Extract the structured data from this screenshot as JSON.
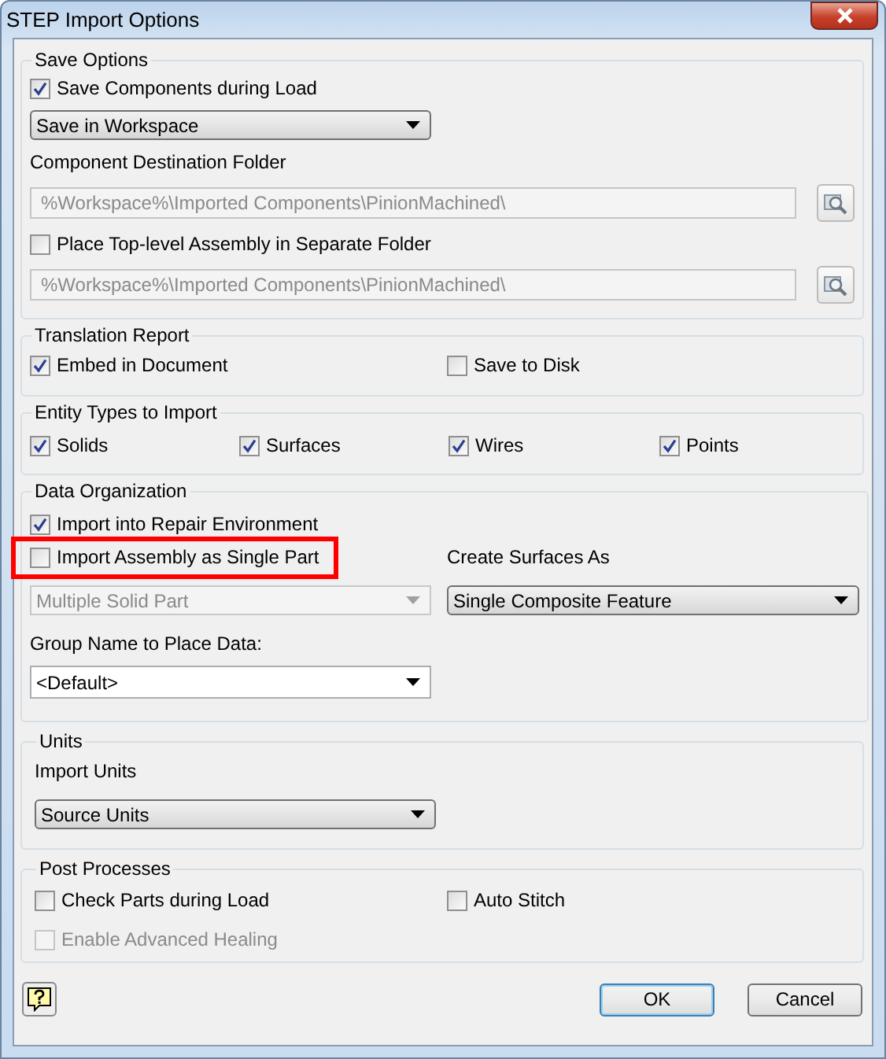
{
  "window": {
    "title": "STEP Import Options"
  },
  "save_options": {
    "title": "Save Options",
    "save_components": {
      "label": "Save Components during Load",
      "checked": true
    },
    "save_location": {
      "value": "Save in Workspace",
      "disabled": false,
      "editable": false
    },
    "destination_label": "Component Destination Folder",
    "destination_folder": {
      "value": "%Workspace%\\Imported Components\\PinionMachined\\",
      "disabled": true
    },
    "separate_folder": {
      "label": "Place Top-level Assembly in Separate Folder",
      "checked": false
    },
    "separate_folder_path": {
      "value": "%Workspace%\\Imported Components\\PinionMachined\\",
      "disabled": true
    }
  },
  "translation_report": {
    "title": "Translation Report",
    "options": [
      {
        "label": "Embed in Document",
        "checked": true
      },
      {
        "label": "Save to Disk",
        "checked": false
      }
    ]
  },
  "entity_types": {
    "title": "Entity Types to Import",
    "options": [
      {
        "label": "Solids",
        "checked": true
      },
      {
        "label": "Surfaces",
        "checked": true
      },
      {
        "label": "Wires",
        "checked": true
      },
      {
        "label": "Points",
        "checked": true
      }
    ]
  },
  "data_organization": {
    "title": "Data Organization",
    "repair": {
      "label": "Import into Repair Environment",
      "checked": true
    },
    "single_part": {
      "label": "Import Assembly as Single Part",
      "checked": false,
      "highlighted": true
    },
    "part_type": {
      "value": "Multiple Solid Part",
      "disabled": true,
      "editable": false
    },
    "surfaces_label": "Create Surfaces As",
    "surfaces": {
      "value": "Single Composite Feature",
      "disabled": false,
      "editable": false
    },
    "group_label": "Group Name to Place Data:",
    "group_name": {
      "value": "<Default>",
      "disabled": false,
      "editable": true
    }
  },
  "units": {
    "title": "Units",
    "label": "Import Units",
    "import_units": {
      "value": "Source Units",
      "disabled": false,
      "editable": false
    }
  },
  "post_processes": {
    "title": "Post Processes",
    "check_parts": {
      "label": "Check Parts during Load",
      "checked": false
    },
    "auto_stitch": {
      "label": "Auto Stitch",
      "checked": false
    },
    "advanced_healing": {
      "label": "Enable Advanced Healing",
      "checked": false,
      "disabled": true
    }
  },
  "buttons": [
    {
      "label": "OK",
      "default": true
    },
    {
      "label": "Cancel",
      "default": false
    }
  ]
}
